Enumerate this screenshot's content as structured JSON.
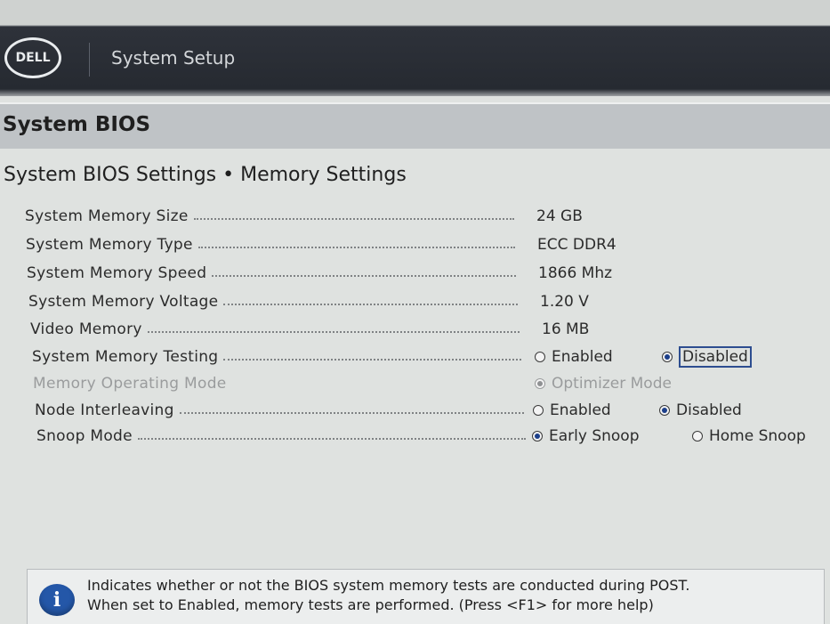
{
  "header": {
    "logo_text": "DELL",
    "app_title": "System Setup"
  },
  "section": {
    "title": "System BIOS"
  },
  "page": {
    "title": "System BIOS Settings • Memory Settings"
  },
  "settings": [
    {
      "label": "System Memory Size",
      "value": "24 GB"
    },
    {
      "label": "System Memory Type",
      "value": "ECC DDR4"
    },
    {
      "label": "System Memory Speed",
      "value": "1866 Mhz"
    },
    {
      "label": "System Memory Voltage",
      "value": "1.20 V"
    },
    {
      "label": "Video Memory",
      "value": "16 MB"
    },
    {
      "label": "System Memory Testing",
      "options": [
        "Enabled",
        "Disabled"
      ],
      "selected": "Disabled"
    },
    {
      "label": "Memory Operating Mode",
      "options": [
        "Optimizer Mode"
      ],
      "selected": "Optimizer Mode",
      "disabled": true
    },
    {
      "label": "Node Interleaving",
      "options": [
        "Enabled",
        "Disabled"
      ],
      "selected": "Disabled"
    },
    {
      "label": "Snoop Mode",
      "options": [
        "Early Snoop",
        "Home Snoop"
      ],
      "selected": "Early Snoop"
    }
  ],
  "help": {
    "icon": "info-icon",
    "line1": "Indicates whether or not the BIOS system memory tests are conducted during POST.",
    "line2": "When set to Enabled, memory tests are performed. (Press <F1> for more help)"
  },
  "colors": {
    "header_bg": "#262a31",
    "accent": "#2457a8"
  }
}
